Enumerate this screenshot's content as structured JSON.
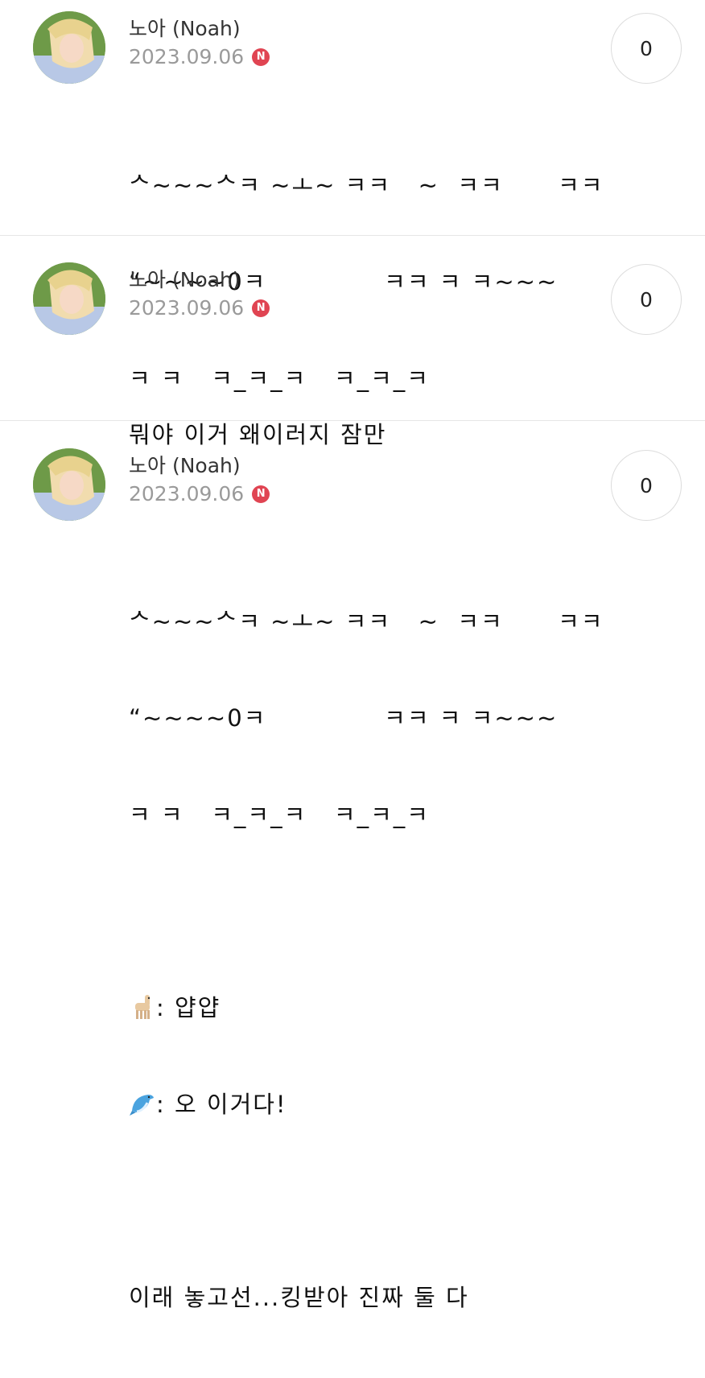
{
  "comments": [
    {
      "author": "노아 (Noah)",
      "date": "2023.09.06",
      "badge": "N",
      "likes": "0",
      "lines": [
        "ᄉ~~~ᄉㅋ ~ㅗ~ ㅋㅋ   ~  ㅋㅋ      ㅋㅋ",
        "“~~~~0ㅋ             ㅋㅋ ㅋ ㅋ~~~",
        "ㅋ ㅋ   ㅋ_ㅋ_ㅋ   ㅋ_ㅋ_ㅋ"
      ]
    },
    {
      "author": "노아 (Noah)",
      "date": "2023.09.06",
      "badge": "N",
      "likes": "0",
      "lines": [
        "뭐야 이거 왜이러지 잠만"
      ]
    },
    {
      "author": "노아 (Noah)",
      "date": "2023.09.06",
      "badge": "N",
      "likes": "0",
      "lines": [
        "ᄉ~~~ᄉㅋ ~ㅗ~ ㅋㅋ   ~  ㅋㅋ      ㅋㅋ",
        "“~~~~0ㅋ             ㅋㅋ ㅋ ㅋ~~~",
        "ㅋ ㅋ   ㅋ_ㅋ_ㅋ   ㅋ_ㅋ_ㅋ"
      ],
      "emoji_lines": [
        {
          "icon": "llama-emoji",
          "text": ": 얍얍"
        },
        {
          "icon": "dolphin-emoji",
          "text": ": 오 이거다!"
        }
      ],
      "closing": "이래 놓고선...킹받아 진짜 둘 다"
    }
  ]
}
